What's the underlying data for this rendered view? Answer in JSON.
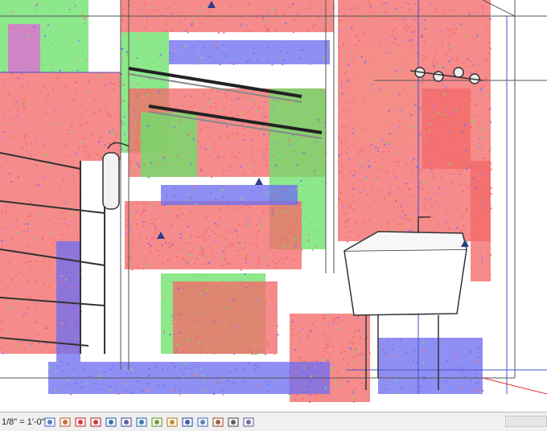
{
  "view_scale": "1/8\" = 1'-0\"",
  "view_controls": [
    {
      "name": "detail-level-icon"
    },
    {
      "name": "visual-style-icon"
    },
    {
      "name": "sun-path-off-icon"
    },
    {
      "name": "shadows-off-icon"
    },
    {
      "name": "show-rendering-icon"
    },
    {
      "name": "crop-view-icon"
    },
    {
      "name": "show-crop-region-icon"
    },
    {
      "name": "unlock-3d-view-icon"
    },
    {
      "name": "temporary-hide-isolate-icon"
    },
    {
      "name": "reveal-hidden-elements-icon"
    },
    {
      "name": "worksharing-display-icon"
    },
    {
      "name": "temporary-view-properties-icon"
    },
    {
      "name": "hide-analytical-model-icon"
    },
    {
      "name": "highlight-displacement-icon"
    }
  ],
  "palette": {
    "red": "#f46a6a",
    "salmon": "#f58f86",
    "green": "#6de26a",
    "blue": "#7070f0",
    "violet": "#a080f0",
    "magenta": "#e06ad8",
    "navy": "#4650c8"
  }
}
